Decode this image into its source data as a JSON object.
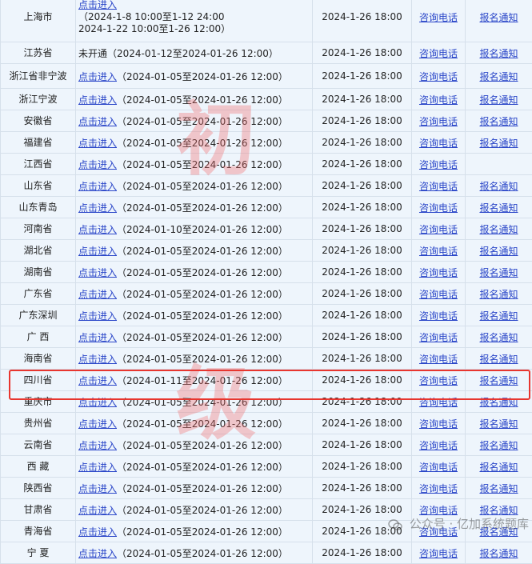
{
  "rows": [
    {
      "region": "上海市",
      "link": "点击进入",
      "ranges": [
        "（2024-1-8 10:00至1-12 24:00",
        "2024-1-22 10:00至1-26 12:00）"
      ],
      "date": "2024-1-26 18:00",
      "phone": "咨询电话",
      "notice": "报名通知"
    },
    {
      "region": "江苏省",
      "prefix": "未开通",
      "range": "（2024-01-12至2024-01-26 12:00）",
      "date": "2024-1-26 18:00",
      "phone": "咨询电话",
      "notice": "报名通知"
    },
    {
      "region": "浙江省非宁波",
      "link": "点击进入",
      "range": "（2024-01-05至2024-01-26 12:00）",
      "date": "2024-1-26 18:00",
      "phone": "咨询电话",
      "notice": "报名通知"
    },
    {
      "region": "浙江宁波",
      "link": "点击进入",
      "range": "（2024-01-05至2024-01-26 12:00）",
      "date": "2024-1-26 18:00",
      "phone": "咨询电话",
      "notice": "报名通知"
    },
    {
      "region": "安徽省",
      "link": "点击进入",
      "range": "（2024-01-05至2024-01-26 12:00）",
      "date": "2024-1-26 18:00",
      "phone": "咨询电话",
      "notice": "报名通知"
    },
    {
      "region": "福建省",
      "link": "点击进入",
      "range": "（2024-01-05至2024-01-26 12:00）",
      "date": "2024-1-26 18:00",
      "phone": "咨询电话",
      "notice": "报名通知"
    },
    {
      "region": "江西省",
      "link": "点击进入",
      "range": "（2024-01-05至2024-01-26 12:00）",
      "date": "2024-1-26 18:00",
      "phone": "咨询电话",
      "notice": ""
    },
    {
      "region": "山东省",
      "link": "点击进入",
      "range": "（2024-01-05至2024-01-26 12:00）",
      "date": "2024-1-26 18:00",
      "phone": "咨询电话",
      "notice": "报名通知"
    },
    {
      "region": "山东青岛",
      "link": "点击进入",
      "range": "（2024-01-05至2024-01-26 12:00）",
      "date": "2024-1-26 18:00",
      "phone": "咨询电话",
      "notice": "报名通知"
    },
    {
      "region": "河南省",
      "link": "点击进入",
      "range": "（2024-01-10至2024-01-26 12:00）",
      "date": "2024-1-26 18:00",
      "phone": "咨询电话",
      "notice": "报名通知"
    },
    {
      "region": "湖北省",
      "link": "点击进入",
      "range": "（2024-01-05至2024-01-26 12:00）",
      "date": "2024-1-26 18:00",
      "phone": "咨询电话",
      "notice": "报名通知"
    },
    {
      "region": "湖南省",
      "link": "点击进入",
      "range": "（2024-01-05至2024-01-26 12:00）",
      "date": "2024-1-26 18:00",
      "phone": "咨询电话",
      "notice": "报名通知"
    },
    {
      "region": "广东省",
      "link": "点击进入",
      "range": "（2024-01-05至2024-01-26 12:00）",
      "date": "2024-1-26 18:00",
      "phone": "咨询电话",
      "notice": "报名通知"
    },
    {
      "region": "广东深圳",
      "link": "点击进入",
      "range": "（2024-01-05至2024-01-26 12:00）",
      "date": "2024-1-26 18:00",
      "phone": "咨询电话",
      "notice": "报名通知"
    },
    {
      "region": "广 西",
      "link": "点击进入",
      "range": "（2024-01-05至2024-01-26 12:00）",
      "date": "2024-1-26 18:00",
      "phone": "咨询电话",
      "notice": "报名通知"
    },
    {
      "region": "海南省",
      "link": "点击进入",
      "range": "（2024-01-05至2024-01-26 12:00）",
      "date": "2024-1-26 18:00",
      "phone": "咨询电话",
      "notice": "报名通知"
    },
    {
      "region": "四川省",
      "link": "点击进入",
      "range": "（2024-01-11至2024-01-26 12:00）",
      "date": "2024-1-26 18:00",
      "phone": "咨询电话",
      "notice": "报名通知",
      "highlight": true
    },
    {
      "region": "重庆市",
      "link": "点击进入",
      "range": "（2024-01-05至2024-01-26 12:00）",
      "date": "2024-1-26 18:00",
      "phone": "咨询电话",
      "notice": "报名通知"
    },
    {
      "region": "贵州省",
      "link": "点击进入",
      "range": "（2024-01-05至2024-01-26 12:00）",
      "date": "2024-1-26 18:00",
      "phone": "咨询电话",
      "notice": "报名通知"
    },
    {
      "region": "云南省",
      "link": "点击进入",
      "range": "（2024-01-05至2024-01-26 12:00）",
      "date": "2024-1-26 18:00",
      "phone": "咨询电话",
      "notice": "报名通知"
    },
    {
      "region": "西 藏",
      "link": "点击进入",
      "range": "（2024-01-05至2024-01-26 12:00）",
      "date": "2024-1-26 18:00",
      "phone": "咨询电话",
      "notice": "报名通知"
    },
    {
      "region": "陕西省",
      "link": "点击进入",
      "range": "（2024-01-05至2024-01-26 12:00）",
      "date": "2024-1-26 18:00",
      "phone": "咨询电话",
      "notice": "报名通知"
    },
    {
      "region": "甘肃省",
      "link": "点击进入",
      "range": "（2024-01-05至2024-01-26 12:00）",
      "date": "2024-1-26 18:00",
      "phone": "咨询电话",
      "notice": "报名通知"
    },
    {
      "region": "青海省",
      "link": "点击进入",
      "range": "（2024-01-05至2024-01-26 12:00）",
      "date": "2024-1-26 18:00",
      "phone": "咨询电话",
      "notice": "报名通知"
    },
    {
      "region": "宁 夏",
      "link": "点击进入",
      "range": "（2024-01-05至2024-01-26 12:00）",
      "date": "2024-1-26 18:00",
      "phone": "咨询电话",
      "notice": "报名通知"
    }
  ],
  "watermark": [
    "初",
    "级"
  ],
  "account": "公众号 · 亿加系统题库"
}
